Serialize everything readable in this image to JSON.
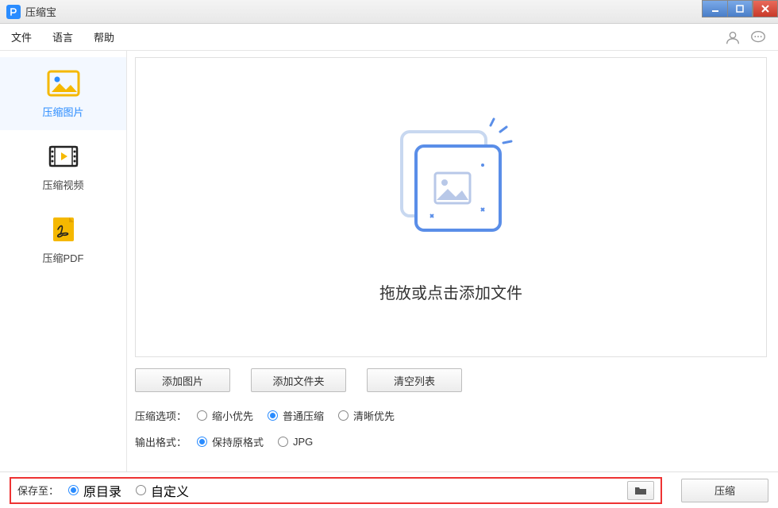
{
  "app_title": "压缩宝",
  "menu": {
    "file": "文件",
    "language": "语言",
    "help": "帮助"
  },
  "sidebar": {
    "items": [
      {
        "label": "压缩图片"
      },
      {
        "label": "压缩视频"
      },
      {
        "label": "压缩PDF"
      }
    ]
  },
  "drop_prompt": "拖放或点击添加文件",
  "buttons": {
    "add_image": "添加图片",
    "add_folder": "添加文件夹",
    "clear_list": "清空列表",
    "compress": "压缩"
  },
  "options": {
    "compress_label": "压缩选项：",
    "compress_choices": [
      "缩小优先",
      "普通压缩",
      "清晰优先"
    ],
    "compress_selected": 1,
    "format_label": "输出格式：",
    "format_choices": [
      "保持原格式",
      "JPG"
    ],
    "format_selected": 0
  },
  "save": {
    "label": "保存至：",
    "choices": [
      "原目录",
      "自定义"
    ],
    "selected": 0
  }
}
